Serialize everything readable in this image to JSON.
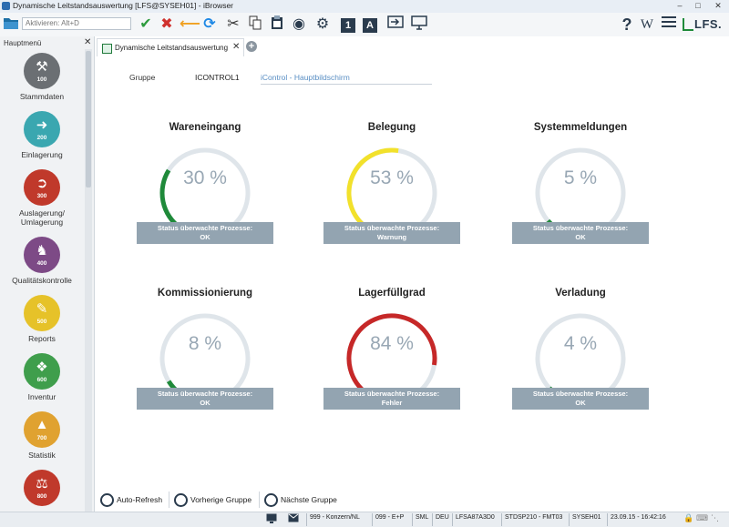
{
  "window": {
    "title": "Dynamische Leitstandsauswertung [LFS@SYSEH01] - iBrowser"
  },
  "toolbar": {
    "command_placeholder": "Aktivieren: Alt+D",
    "icons": [
      "folder-icon",
      "check-icon",
      "cancel-icon",
      "back-arrow-icon",
      "refresh-icon",
      "cut-icon",
      "copy-icon",
      "paste-icon",
      "palette-icon",
      "settings-icon",
      "font-1-icon",
      "font-a-icon",
      "export-icon",
      "monitor-icon",
      "help-icon",
      "wiki-icon",
      "menu-icon"
    ],
    "btn_1": "1",
    "btn_a": "A",
    "help": "?",
    "wiki": "W",
    "brand": "LFS."
  },
  "sidebar": {
    "header": "Hauptmenü",
    "items": [
      {
        "label": "Stammdaten",
        "code": "100",
        "color": "#6b6f73",
        "icon": "tools-icon"
      },
      {
        "label": "Einlagerung",
        "code": "200",
        "color": "#3aa7b0",
        "icon": "store-in-icon"
      },
      {
        "label": "Auslagerung/ Umlagerung",
        "code": "300",
        "color": "#c0392b",
        "icon": "store-out-icon"
      },
      {
        "label": "Qualitätskontrolle",
        "code": "400",
        "color": "#7d4a86",
        "icon": "stamp-icon"
      },
      {
        "label": "Reports",
        "code": "500",
        "color": "#e6c229",
        "icon": "reports-icon"
      },
      {
        "label": "Inventur",
        "code": "600",
        "color": "#3f9e4c",
        "icon": "inventory-icon"
      },
      {
        "label": "Statistik",
        "code": "700",
        "color": "#e0a230",
        "icon": "chart-icon"
      },
      {
        "label": "",
        "code": "800",
        "color": "#c0392b",
        "icon": "scales-icon"
      }
    ]
  },
  "tabs": [
    {
      "label": "Dynamische Leitstandsauswertung"
    }
  ],
  "group": {
    "label": "Gruppe",
    "code": "ICONTROL1",
    "description": "iControl - Hauptbildschirm"
  },
  "gauges": [
    {
      "title": "Wareneingang",
      "value": 30,
      "value_text": "30 %",
      "color": "#1f8a3a",
      "status_line1": "Status überwachte Prozesse:",
      "status_line2": "OK"
    },
    {
      "title": "Belegung",
      "value": 53,
      "value_text": "53 %",
      "color": "#f2e12b",
      "status_line1": "Status überwachte Prozesse:",
      "status_line2": "Warnung"
    },
    {
      "title": "Systemmeldungen",
      "value": 5,
      "value_text": "5 %",
      "color": "#1f8a3a",
      "status_line1": "Status überwachte Prozesse:",
      "status_line2": "OK"
    },
    {
      "title": "Kommissionierung",
      "value": 8,
      "value_text": "8 %",
      "color": "#1f8a3a",
      "status_line1": "Status überwachte Prozesse:",
      "status_line2": "OK"
    },
    {
      "title": "Lagerfüllgrad",
      "value": 84,
      "value_text": "84 %",
      "color": "#c62828",
      "status_line1": "Status überwachte Prozesse:",
      "status_line2": "Fehler"
    },
    {
      "title": "Verladung",
      "value": 4,
      "value_text": "4 %",
      "color": "#1f8a3a",
      "status_line1": "Status überwachte Prozesse:",
      "status_line2": "OK"
    }
  ],
  "controls": {
    "auto_refresh": "Auto-Refresh",
    "prev_group": "Vorherige Gruppe",
    "next_group": "Nächste Gruppe"
  },
  "statusbar": {
    "items": [
      "999 - Konzern/NL",
      "099 - E+P",
      "SML",
      "DEU",
      "LFSA87A3D0",
      "STDSP210 - FMT03",
      "SYSEH01",
      "23.09.15 - 16:42:16"
    ]
  }
}
